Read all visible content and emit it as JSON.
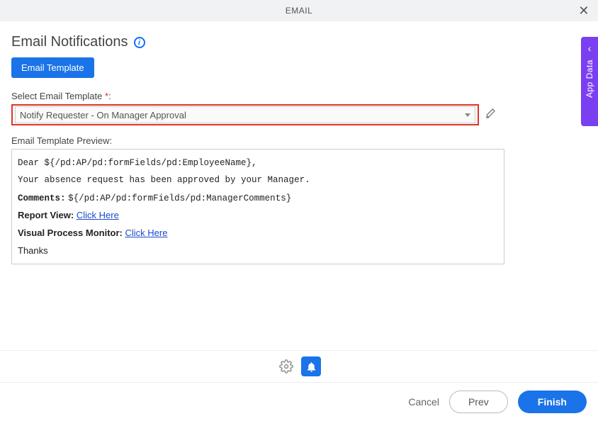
{
  "header": {
    "title": "EMAIL"
  },
  "page": {
    "title": "Email Notifications",
    "tab_label": "Email Template",
    "select_label": "Select Email Template ",
    "required_marker": "*",
    "select_colon": ":",
    "selected_template": "Notify Requester - On Manager Approval",
    "preview_label": "Email Template Preview:"
  },
  "preview": {
    "greeting_prefix": "Dear ",
    "greeting_token": "${/pd:AP/pd:formFields/pd:EmployeeName}",
    "greeting_suffix": ",",
    "body_line": "Your absence request has been approved by your Manager.",
    "comments_label": "Comments:",
    "comments_token": "${/pd:AP/pd:formFields/pd:ManagerComments}",
    "report_label": "Report View:",
    "report_link": "Click Here",
    "vpm_label": "Visual Process Monitor:",
    "vpm_link": "Click Here",
    "thanks": "Thanks"
  },
  "footer": {
    "cancel": "Cancel",
    "prev": "Prev",
    "finish": "Finish"
  },
  "sidetab": {
    "label": "App Data"
  }
}
